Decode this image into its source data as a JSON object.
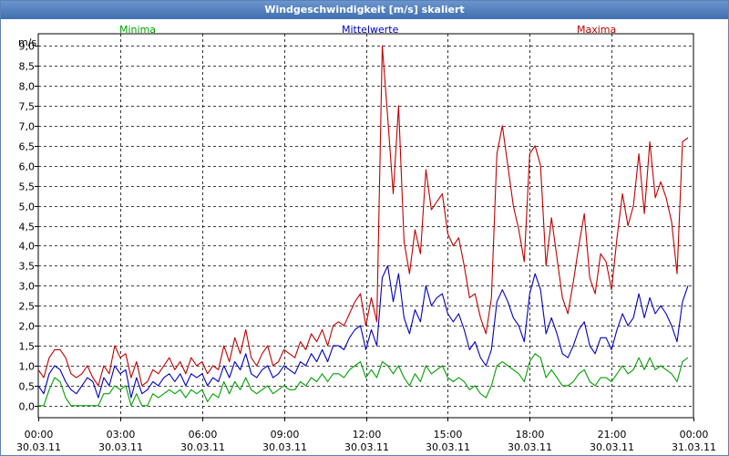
{
  "window": {
    "title": "Windgeschwindigkeit [m/s] skaliert"
  },
  "legend": [
    {
      "label": "Minima",
      "color": "#00a000"
    },
    {
      "label": "Mittelwerte",
      "color": "#0000c0"
    },
    {
      "label": "Maxima",
      "color": "#c00000"
    }
  ],
  "chart_data": {
    "type": "line",
    "title": "Windgeschwindigkeit [m/s] skaliert",
    "ylabel": "m/s",
    "ylim": [
      -0.3,
      9.3
    ],
    "y_ticks": [
      "0,0",
      "0,5",
      "1,0",
      "1,5",
      "2,0",
      "2,5",
      "3,0",
      "3,5",
      "4,0",
      "4,5",
      "5,0",
      "5,5",
      "6,0",
      "6,5",
      "7,0",
      "7,5",
      "8,0",
      "8,5",
      "9,0"
    ],
    "x_ticks": [
      {
        "time": "00:00",
        "date": "30.03.11"
      },
      {
        "time": "03:00",
        "date": "30.03.11"
      },
      {
        "time": "06:00",
        "date": "30.03.11"
      },
      {
        "time": "09:00",
        "date": "30.03.11"
      },
      {
        "time": "12:00",
        "date": "30.03.11"
      },
      {
        "time": "15:00",
        "date": "30.03.11"
      },
      {
        "time": "18:00",
        "date": "30.03.11"
      },
      {
        "time": "21:00",
        "date": "30.03.11"
      },
      {
        "time": "00:00",
        "date": "31.03.11"
      }
    ],
    "x_hours": [
      0,
      0.2,
      0.4,
      0.6,
      0.8,
      1.0,
      1.2,
      1.4,
      1.6,
      1.8,
      2.0,
      2.2,
      2.4,
      2.6,
      2.8,
      3.0,
      3.2,
      3.4,
      3.6,
      3.8,
      4.0,
      4.2,
      4.4,
      4.6,
      4.8,
      5.0,
      5.2,
      5.4,
      5.6,
      5.8,
      6.0,
      6.2,
      6.4,
      6.6,
      6.8,
      7.0,
      7.2,
      7.4,
      7.6,
      7.8,
      8.0,
      8.2,
      8.4,
      8.6,
      8.8,
      9.0,
      9.2,
      9.4,
      9.6,
      9.8,
      10.0,
      10.2,
      10.4,
      10.6,
      10.8,
      11.0,
      11.2,
      11.4,
      11.6,
      11.8,
      12.0,
      12.2,
      12.4,
      12.6,
      12.8,
      13.0,
      13.2,
      13.4,
      13.6,
      13.8,
      14.0,
      14.2,
      14.4,
      14.6,
      14.8,
      15.0,
      15.2,
      15.4,
      15.6,
      15.8,
      16.0,
      16.2,
      16.4,
      16.6,
      16.8,
      17.0,
      17.2,
      17.4,
      17.6,
      17.8,
      18.0,
      18.2,
      18.4,
      18.6,
      18.8,
      19.0,
      19.2,
      19.4,
      19.6,
      19.8,
      20.0,
      20.2,
      20.4,
      20.6,
      20.8,
      21.0,
      21.2,
      21.4,
      21.6,
      21.8,
      22.0,
      22.2,
      22.4,
      22.6,
      22.8,
      23.0,
      23.2,
      23.4,
      23.6,
      23.8
    ],
    "series": [
      {
        "name": "Maxima",
        "color": "#c00000",
        "values": [
          0.9,
          0.7,
          1.2,
          1.4,
          1.4,
          1.2,
          0.8,
          0.7,
          0.8,
          1.0,
          0.7,
          0.5,
          1.0,
          0.8,
          1.5,
          1.2,
          1.3,
          0.7,
          1.1,
          0.5,
          0.6,
          0.9,
          0.8,
          1.0,
          1.2,
          0.9,
          1.1,
          0.8,
          1.2,
          1.0,
          1.1,
          0.8,
          1.0,
          0.9,
          1.5,
          1.1,
          1.7,
          1.3,
          1.9,
          1.2,
          1.0,
          1.3,
          1.5,
          1.0,
          1.1,
          1.4,
          1.3,
          1.2,
          1.6,
          1.4,
          1.8,
          1.6,
          1.9,
          1.5,
          2.0,
          2.1,
          2.0,
          2.3,
          2.6,
          2.8,
          2.0,
          2.7,
          2.1,
          9.0,
          7.2,
          5.3,
          7.5,
          4.1,
          3.3,
          4.4,
          3.8,
          5.9,
          4.9,
          5.1,
          5.3,
          4.3,
          4.0,
          4.2,
          3.5,
          2.7,
          2.8,
          2.2,
          1.8,
          2.7,
          6.3,
          7.0,
          6.0,
          5.0,
          4.4,
          3.6,
          6.3,
          6.5,
          6.0,
          3.5,
          4.7,
          3.7,
          2.7,
          2.3,
          3.1,
          4.0,
          4.8,
          3.2,
          2.8,
          3.8,
          3.6,
          2.9,
          4.2,
          5.3,
          4.5,
          5.0,
          6.3,
          4.8,
          6.6,
          5.2,
          5.6,
          5.2,
          4.6,
          3.3,
          6.6,
          6.7
        ]
      },
      {
        "name": "Mittelwerte",
        "color": "#0000c0",
        "values": [
          0.5,
          0.3,
          0.8,
          1.0,
          0.9,
          0.6,
          0.4,
          0.3,
          0.5,
          0.7,
          0.6,
          0.2,
          0.7,
          0.5,
          1.0,
          0.8,
          0.9,
          0.2,
          0.7,
          0.3,
          0.4,
          0.6,
          0.5,
          0.7,
          0.8,
          0.6,
          0.8,
          0.5,
          0.8,
          0.7,
          0.8,
          0.5,
          0.7,
          0.6,
          1.0,
          0.7,
          1.1,
          0.9,
          1.3,
          0.8,
          0.7,
          0.9,
          1.0,
          0.7,
          0.8,
          1.0,
          0.9,
          0.8,
          1.1,
          1.0,
          1.3,
          1.1,
          1.4,
          1.1,
          1.5,
          1.5,
          1.4,
          1.7,
          1.9,
          2.0,
          1.4,
          1.9,
          1.5,
          3.2,
          3.5,
          2.6,
          3.3,
          2.2,
          1.8,
          2.4,
          2.1,
          3.0,
          2.5,
          2.7,
          2.8,
          2.3,
          2.1,
          2.3,
          1.9,
          1.4,
          1.6,
          1.2,
          1.0,
          1.4,
          2.6,
          2.9,
          2.6,
          2.2,
          2.0,
          1.6,
          2.8,
          3.3,
          2.9,
          1.8,
          2.2,
          1.8,
          1.3,
          1.2,
          1.5,
          1.9,
          2.1,
          1.5,
          1.3,
          1.7,
          1.7,
          1.4,
          1.9,
          2.3,
          2.0,
          2.2,
          2.8,
          2.2,
          2.7,
          2.3,
          2.5,
          2.3,
          2.0,
          1.6,
          2.6,
          3.0
        ]
      },
      {
        "name": "Minima",
        "color": "#00a000",
        "values": [
          0.0,
          0.0,
          0.4,
          0.7,
          0.6,
          0.2,
          0.0,
          0.0,
          0.0,
          0.0,
          0.0,
          0.0,
          0.3,
          0.3,
          0.5,
          0.4,
          0.5,
          0.0,
          0.3,
          0.0,
          0.0,
          0.3,
          0.2,
          0.3,
          0.4,
          0.3,
          0.4,
          0.2,
          0.4,
          0.3,
          0.4,
          0.1,
          0.3,
          0.2,
          0.6,
          0.3,
          0.6,
          0.4,
          0.7,
          0.4,
          0.3,
          0.4,
          0.5,
          0.3,
          0.4,
          0.5,
          0.4,
          0.4,
          0.6,
          0.5,
          0.7,
          0.6,
          0.8,
          0.6,
          0.8,
          0.8,
          0.7,
          0.9,
          1.0,
          1.1,
          0.7,
          0.9,
          0.7,
          1.1,
          1.0,
          0.8,
          1.0,
          0.7,
          0.5,
          0.8,
          0.6,
          1.0,
          0.8,
          0.9,
          1.0,
          0.7,
          0.6,
          0.7,
          0.6,
          0.4,
          0.5,
          0.3,
          0.2,
          0.5,
          1.0,
          1.1,
          1.0,
          0.9,
          0.8,
          0.6,
          1.1,
          1.3,
          1.2,
          0.7,
          0.9,
          0.7,
          0.5,
          0.5,
          0.6,
          0.8,
          0.9,
          0.6,
          0.5,
          0.7,
          0.7,
          0.6,
          0.8,
          1.0,
          0.8,
          0.9,
          1.2,
          0.9,
          1.2,
          0.9,
          1.0,
          0.9,
          0.8,
          0.6,
          1.1,
          1.2
        ]
      }
    ],
    "grid": true
  }
}
